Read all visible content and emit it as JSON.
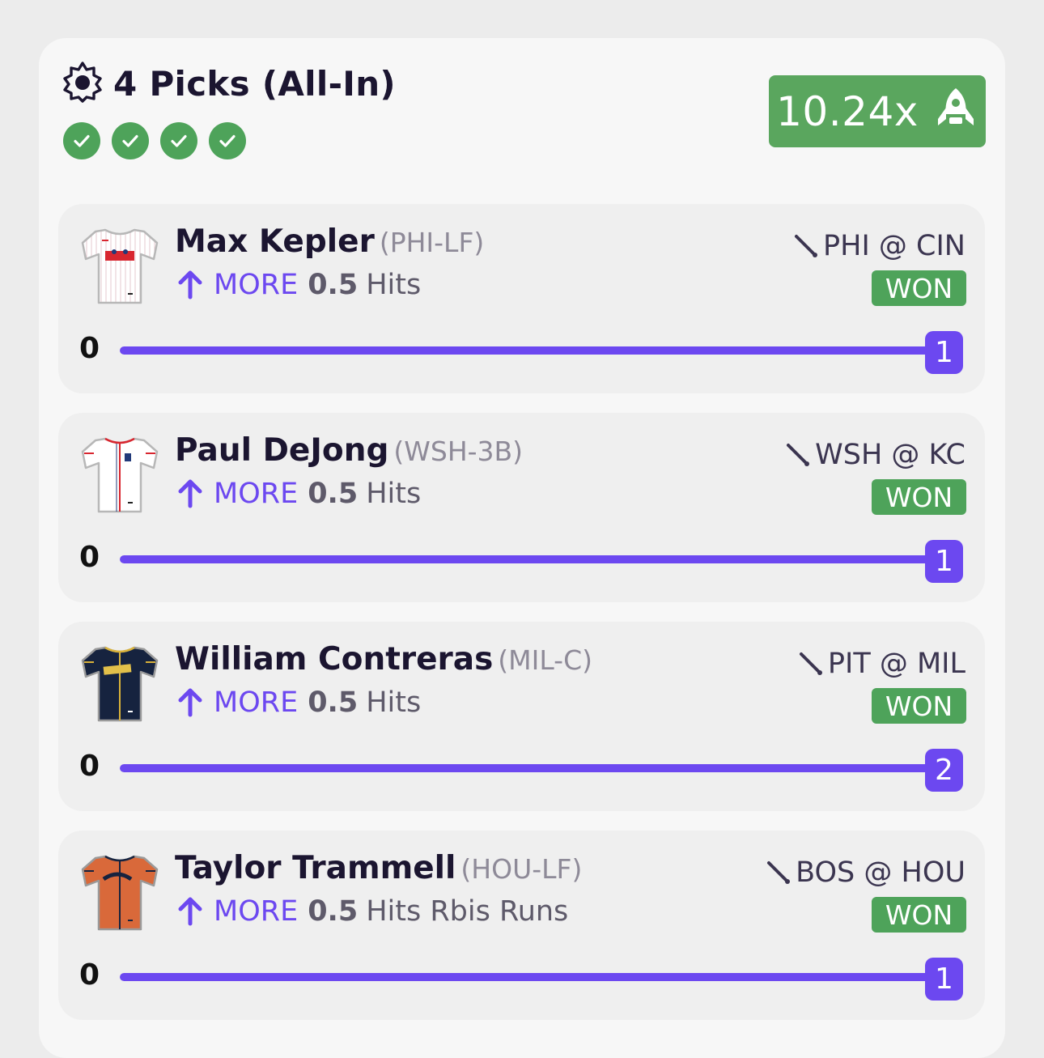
{
  "entry": {
    "title": "4 Picks (All-In)",
    "multiplier": "10.24x",
    "check_count": 4,
    "accent_color": "#6c48f0",
    "won_color": "#4ea35a"
  },
  "picks": [
    {
      "player": "Max Kepler",
      "pos": "(PHI-LF)",
      "direction": "MORE",
      "line": "0.5",
      "stat": "Hits",
      "matchup": "PHI @ CIN",
      "status": "WON",
      "min": "0",
      "value": "1",
      "progress": 1.0,
      "jersey_icon": "phillies-jersey-icon"
    },
    {
      "player": "Paul DeJong",
      "pos": "(WSH-3B)",
      "direction": "MORE",
      "line": "0.5",
      "stat": "Hits",
      "matchup": "WSH @ KC",
      "status": "WON",
      "min": "0",
      "value": "1",
      "progress": 1.0,
      "jersey_icon": "nationals-jersey-icon"
    },
    {
      "player": "William Contreras",
      "pos": "(MIL-C)",
      "direction": "MORE",
      "line": "0.5",
      "stat": "Hits",
      "matchup": "PIT @ MIL",
      "status": "WON",
      "min": "0",
      "value": "2",
      "progress": 1.0,
      "jersey_icon": "brewers-jersey-icon"
    },
    {
      "player": "Taylor Trammell",
      "pos": "(HOU-LF)",
      "direction": "MORE",
      "line": "0.5",
      "stat": "Hits Rbis Runs",
      "matchup": "BOS @ HOU",
      "status": "WON",
      "min": "0",
      "value": "1",
      "progress": 1.0,
      "jersey_icon": "astros-jersey-icon"
    }
  ]
}
